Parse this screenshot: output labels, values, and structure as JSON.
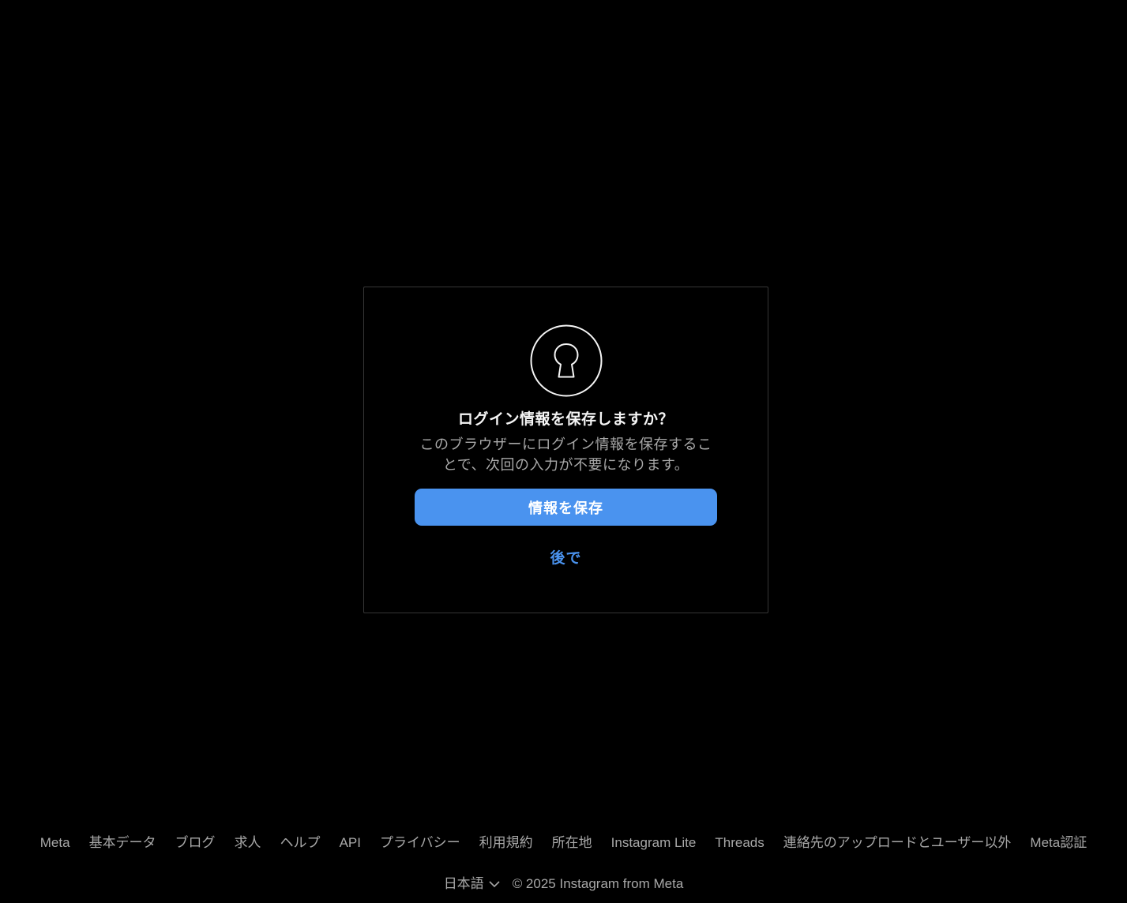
{
  "dialog": {
    "icon": "keyhole-icon",
    "title": "ログイン情報を保存しますか？",
    "description": "このブラウザーにログイン情報を保存することで、次回の入力が不要になります。",
    "save_label": "情報を保存",
    "later_label": "後で"
  },
  "footer": {
    "links": [
      {
        "label": "Meta"
      },
      {
        "label": "基本データ"
      },
      {
        "label": "ブログ"
      },
      {
        "label": "求人"
      },
      {
        "label": "ヘルプ"
      },
      {
        "label": "API"
      },
      {
        "label": "プライバシー"
      },
      {
        "label": "利用規約"
      },
      {
        "label": "所在地"
      },
      {
        "label": "Instagram Lite"
      },
      {
        "label": "Threads"
      },
      {
        "label": "連絡先のアップロードとユーザー以外"
      },
      {
        "label": "Meta認証"
      }
    ],
    "language": "日本語",
    "copyright": "© 2025 Instagram from Meta"
  },
  "colors": {
    "background": "#000000",
    "accent": "#4a93ef",
    "border": "#363636",
    "muted_text": "#a8a8a8"
  }
}
